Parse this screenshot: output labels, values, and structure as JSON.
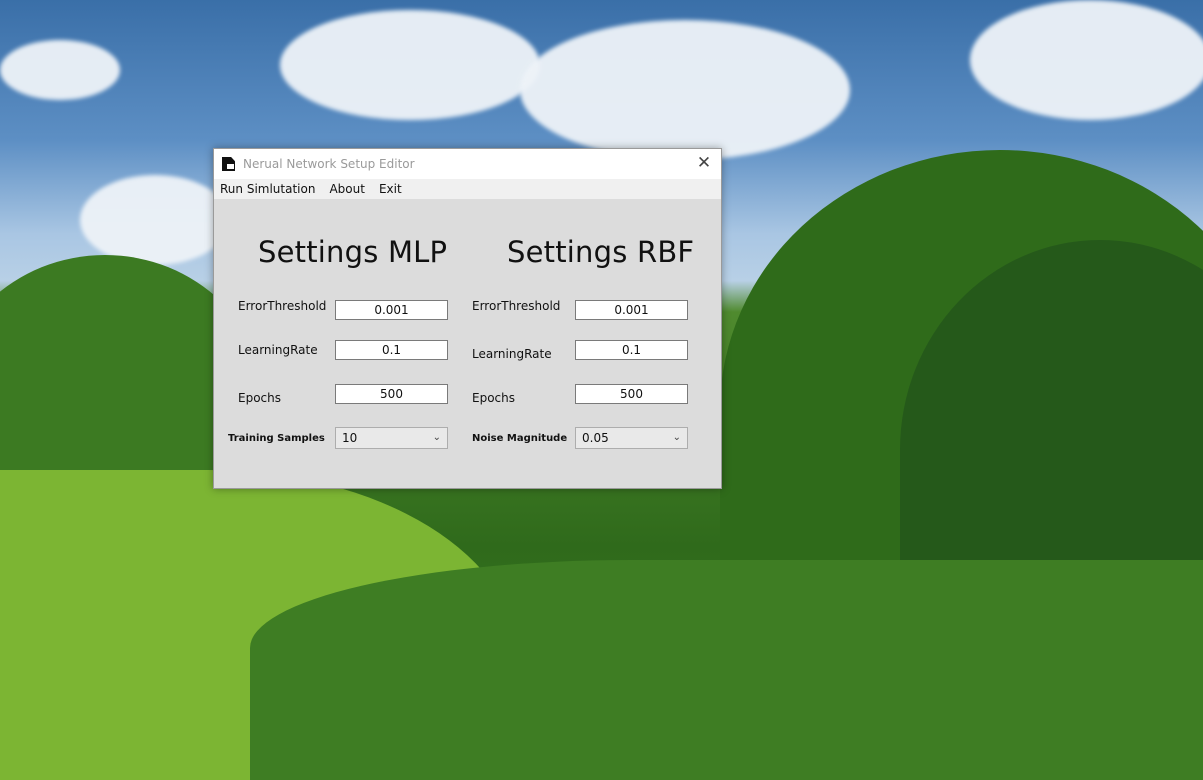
{
  "window": {
    "title": "Nerual Network Setup Editor",
    "close_glyph": "✕"
  },
  "menu": {
    "items": [
      "Run Simlutation",
      "About",
      "Exit"
    ]
  },
  "mlp": {
    "heading": "Settings MLP",
    "error_label": "ErrorThreshold",
    "error_value": "0.001",
    "lr_label": "LearningRate",
    "lr_value": "0.1",
    "epochs_label": "Epochs",
    "epochs_value": "500",
    "samples_label": "Training Samples",
    "samples_value": "10"
  },
  "rbf": {
    "heading": "Settings RBF",
    "error_label": "ErrorThreshold",
    "error_value": "0.001",
    "lr_label": "LearningRate",
    "lr_value": "0.1",
    "epochs_label": "Epochs",
    "epochs_value": "500",
    "noise_label": "Noise Magnitude",
    "noise_value": "0.05"
  },
  "icons": {
    "app": "document-icon",
    "close": "close-icon",
    "dropdown": "chevron-down-icon"
  }
}
